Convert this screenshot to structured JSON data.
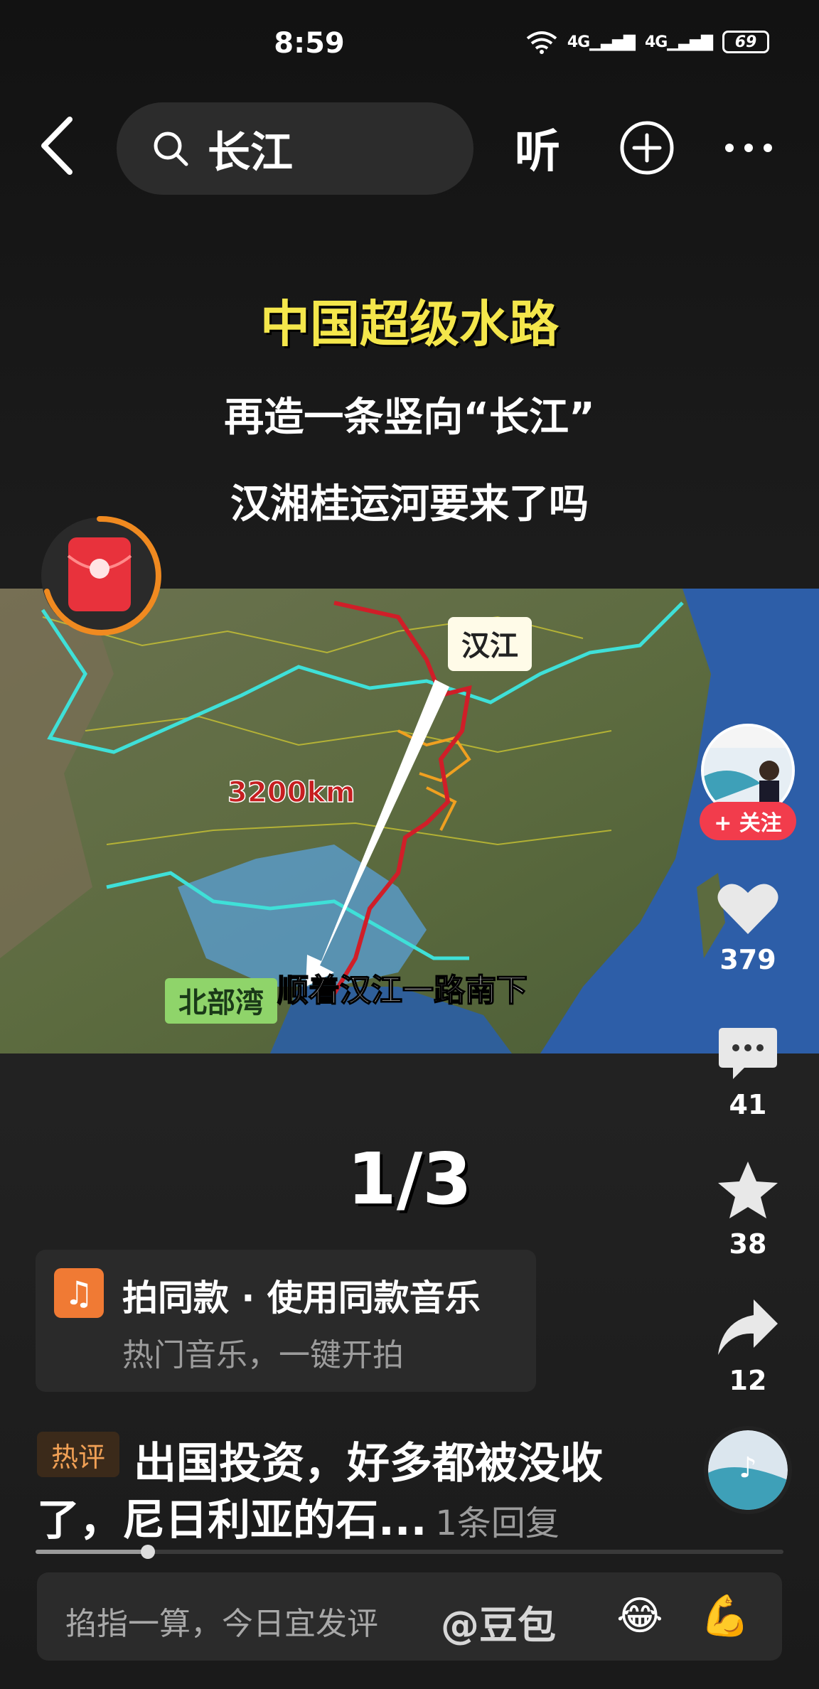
{
  "status_bar": {
    "time": "8:59",
    "signal1": "4G",
    "signal2": "4G",
    "battery": "69"
  },
  "top_nav": {
    "search_query": "长江",
    "listen_label": "听"
  },
  "headline": {
    "title": "中国超级水路",
    "line2": "再造一条竖向“长江”",
    "line3": "汉湘桂运河要来了吗"
  },
  "map": {
    "label_hanjiang": "汉江",
    "label_distance": "3200km",
    "label_beibuwan": "北部湾",
    "label_south": "顺着汉江一路南下",
    "colors": {
      "route": "#d01e28",
      "yangtze": "#3fe0d8",
      "tributary": "#f0a020",
      "sea": "#2d5ea8"
    }
  },
  "page_indicator": "1/3",
  "side_actions": {
    "follow_label": "+ 关注",
    "likes": "379",
    "comments": "41",
    "favorites": "38",
    "shares": "12"
  },
  "music_card": {
    "title": "拍同款 · 使用同款音乐",
    "subtitle": "热门音乐，一键开拍"
  },
  "hot_comment": {
    "tag": "热评",
    "line1": "出国投资，好多都被没收",
    "line2": "了，尼日利亚的石...",
    "reply_count": "1条回复"
  },
  "progress": {
    "fraction": 0.15
  },
  "comment_bar": {
    "placeholder": "掐指一算，今日宜发评",
    "mention": "@豆包",
    "emoji1": "😂",
    "emoji2": "💪"
  }
}
